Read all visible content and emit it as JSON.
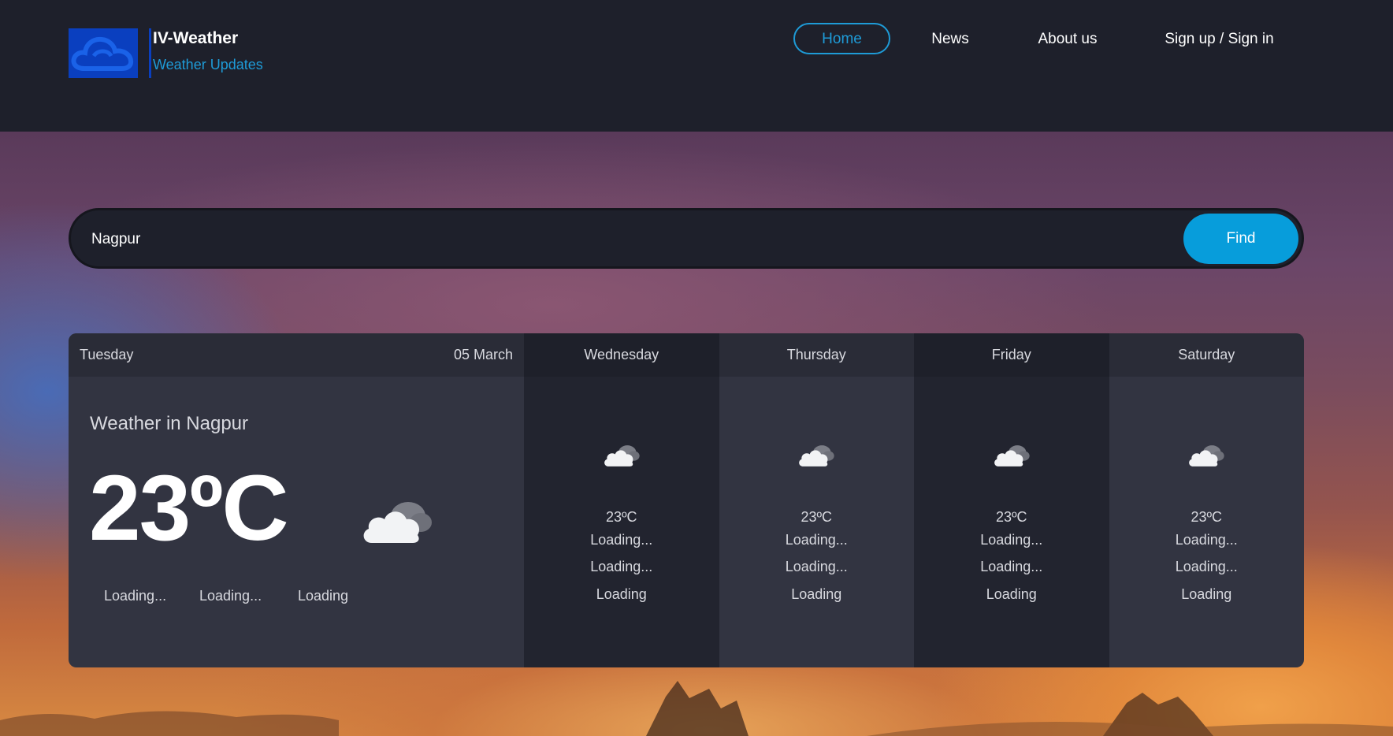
{
  "brand": {
    "name": "IV-Weather",
    "tagline": "Weather Updates",
    "logo_icon": "cloud-logo-icon"
  },
  "nav": {
    "home": "Home",
    "news": "News",
    "about": "About us",
    "sign": "Sign up / Sign in"
  },
  "search": {
    "value": "Nagpur",
    "button": "Find"
  },
  "today": {
    "day": "Tuesday",
    "date": "05 March",
    "location": "Weather in Nagpur",
    "temp": "23ºC",
    "icon": "cloud-icon",
    "stats": [
      "Loading...",
      "Loading...",
      "Loading"
    ]
  },
  "forecast": [
    {
      "day": "Wednesday",
      "temp": "23ºC",
      "l1": "Loading...",
      "l2": "Loading...",
      "l3": "Loading"
    },
    {
      "day": "Thursday",
      "temp": "23ºC",
      "l1": "Loading...",
      "l2": "Loading...",
      "l3": "Loading"
    },
    {
      "day": "Friday",
      "temp": "23ºC",
      "l1": "Loading...",
      "l2": "Loading...",
      "l3": "Loading"
    },
    {
      "day": "Saturday",
      "temp": "23ºC",
      "l1": "Loading...",
      "l2": "Loading...",
      "l3": "Loading"
    }
  ],
  "colors": {
    "accent": "#079ddb",
    "topbar": "#1e202b",
    "logo": "#0a3fbf"
  }
}
